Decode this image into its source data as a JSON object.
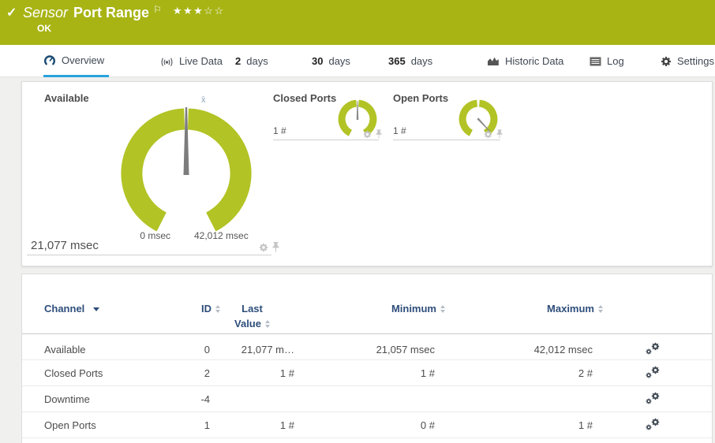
{
  "header": {
    "type_label": "Sensor",
    "title": "Port Range",
    "status": "OK",
    "rating_filled": "★★★",
    "rating_empty": "☆☆"
  },
  "tabs": {
    "overview": "Overview",
    "live_data": "Live Data",
    "d2_num": "2",
    "d2_label": "days",
    "d30_num": "30",
    "d30_label": "days",
    "d365_num": "365",
    "d365_label": "days",
    "historic": "Historic Data",
    "log": "Log",
    "settings": "Settings"
  },
  "gauges": {
    "available": {
      "label": "Available",
      "value": "21,077 msec",
      "min": "0 msec",
      "max": "42,012 msec",
      "mean_marker": "x̄"
    },
    "closed_ports": {
      "label": "Closed Ports",
      "value": "1 #"
    },
    "open_ports": {
      "label": "Open Ports",
      "value": "1 #"
    }
  },
  "table": {
    "col_channel": "Channel",
    "col_id": "ID",
    "col_last_line1": "Last",
    "col_last_line2": "Value",
    "col_min": "Minimum",
    "col_max": "Maximum",
    "rows": [
      {
        "channel": "Available",
        "id": "0",
        "last": "21,077 m…",
        "min": "21,057 msec",
        "max": "42,012 msec"
      },
      {
        "channel": "Closed Ports",
        "id": "2",
        "last": "1 #",
        "min": "1 #",
        "max": "2 #"
      },
      {
        "channel": "Downtime",
        "id": "-4",
        "last": "",
        "min": "",
        "max": ""
      },
      {
        "channel": "Open Ports",
        "id": "1",
        "last": "1 #",
        "min": "0 #",
        "max": "1 #"
      }
    ]
  },
  "colors": {
    "brand_green": "#a8b414",
    "gauge_green": "#b2c325",
    "active_tab_blue": "#2aa3dc",
    "table_header_blue": "#2e4e7b"
  }
}
